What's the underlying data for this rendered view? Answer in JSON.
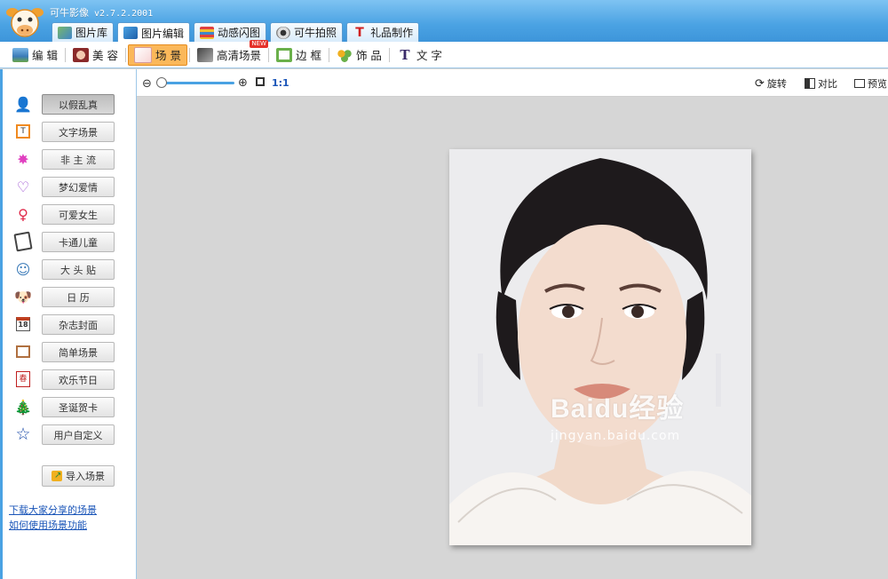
{
  "app": {
    "title": "可牛影像",
    "version": "v2.7.2.2001"
  },
  "tabs": [
    {
      "label": "图片库",
      "icon": "gallery-icon",
      "active": false
    },
    {
      "label": "图片编辑",
      "icon": "edit-image-icon",
      "active": true
    },
    {
      "label": "动感闪图",
      "icon": "flash-gif-icon",
      "active": false
    },
    {
      "label": "可牛拍照",
      "icon": "webcam-icon",
      "active": false
    },
    {
      "label": "礼品制作",
      "icon": "gift-icon",
      "active": false
    }
  ],
  "subtoolbar": [
    {
      "label": "编 辑",
      "icon": "edit-icon",
      "active": false
    },
    {
      "label": "美 容",
      "icon": "beauty-icon",
      "active": false
    },
    {
      "label": "场 景",
      "icon": "scene-icon",
      "active": true
    },
    {
      "label": "高清场景",
      "icon": "hd-scene-icon",
      "active": false,
      "badge": "NEW"
    },
    {
      "label": "边 框",
      "icon": "frame-icon",
      "active": false
    },
    {
      "label": "饰 品",
      "icon": "accessory-icon",
      "active": false
    },
    {
      "label": "文 字",
      "icon": "text-icon",
      "active": false
    }
  ],
  "scenes": [
    {
      "label": "以假乱真",
      "icon": "realistic-icon",
      "active": true
    },
    {
      "label": "文字场景",
      "icon": "text-scene-icon"
    },
    {
      "label": "非 主 流",
      "icon": "sparkle-icon"
    },
    {
      "label": "梦幻爱情",
      "icon": "heart-icon"
    },
    {
      "label": "可爱女生",
      "icon": "female-icon"
    },
    {
      "label": "卡通儿童",
      "icon": "book-icon"
    },
    {
      "label": "大 头 贴",
      "icon": "photo-sticker-icon"
    },
    {
      "label": "日  历",
      "icon": "calendar-dog-icon"
    },
    {
      "label": "杂志封面",
      "icon": "calendar-18-icon"
    },
    {
      "label": "简单场景",
      "icon": "simple-frame-icon"
    },
    {
      "label": "欢乐节日",
      "icon": "spring-festival-icon"
    },
    {
      "label": "圣诞贺卡",
      "icon": "christmas-tree-icon"
    },
    {
      "label": "用户自定义",
      "icon": "star-icon"
    }
  ],
  "import_label": "导入场景",
  "links": {
    "download": "下载大家分享的场景",
    "howto": "如何使用场景功能"
  },
  "canvas_toolbar": {
    "ratio": "1:1",
    "zoom_level": 0.0,
    "rotate": "旋转",
    "compare": "对比",
    "preview": "预览"
  },
  "watermark": {
    "title": "Baidu经验",
    "sub": "jingyan.baidu.com"
  },
  "colors": {
    "accent": "#4aa2e3",
    "active_tab": "#fbb85a",
    "link": "#1a55b8"
  }
}
